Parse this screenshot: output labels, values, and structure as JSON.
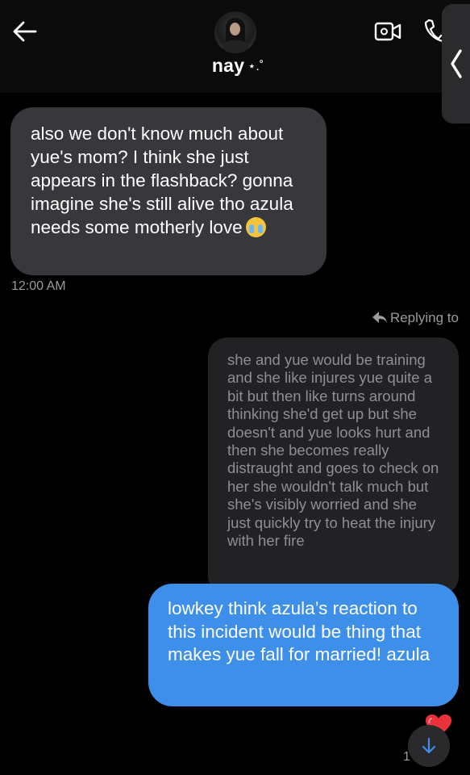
{
  "header": {
    "contact_name": "nay",
    "name_decoration": "⋆.˚"
  },
  "messages": {
    "received": {
      "text": "also we don't know much about yue's mom? I think she just appears in the flashback? gonna imagine she's still alive tho azula needs some motherly love",
      "emoji": "crying-face",
      "time": "12:00 AM"
    },
    "reply_label": "Replying to",
    "quoted_text": "she and yue would be training and she like injures yue quite a bit but then like turns around thinking she'd get up but she doesn't and yue looks hurt and then she becomes really distraught and goes to check on her she wouldn't talk much but she's visibly worried and she just quickly try to heat the injury with her fire",
    "sent": {
      "text": "lowkey think azula’s reaction to this incident would be thing that makes yue fall for married! azula",
      "reaction": "heart",
      "time_start": "1",
      "time_end": "M"
    }
  },
  "colors": {
    "sent_bubble": "#3d8fe9",
    "received_bubble": "#38383c",
    "quoted_bubble": "#222224",
    "reaction_heart": "#e8323c"
  }
}
